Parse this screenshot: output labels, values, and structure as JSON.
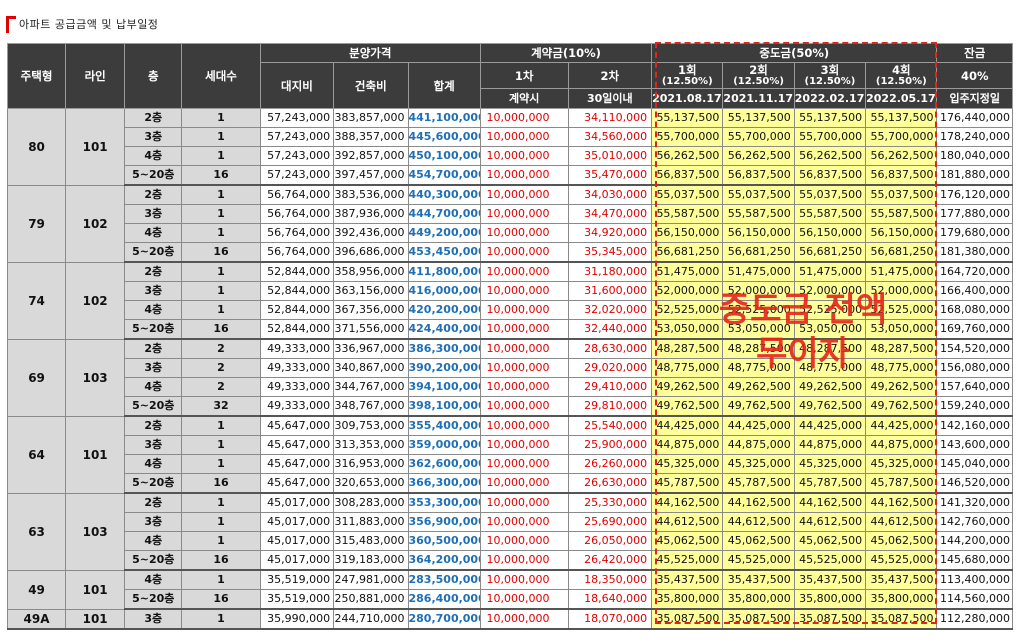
{
  "title": "아파트 공급금액 및 납부일정",
  "headers": {
    "type": "주택형",
    "line": "라인",
    "floor": "층",
    "units": "세대수",
    "sale_price": "분양가격",
    "land": "대지비",
    "building": "건축비",
    "total": "합계",
    "deposit": "계약금(10%)",
    "dep1": "1차",
    "dep2": "2차",
    "dep1_when": "계약시",
    "dep2_when": "30일이내",
    "middle": "중도금(50%)",
    "mid": [
      {
        "n": "1회",
        "r": "(12.50%)",
        "d": "2021.08.17."
      },
      {
        "n": "2회",
        "r": "(12.50%)",
        "d": "2021.11.17."
      },
      {
        "n": "3회",
        "r": "(12.50%)",
        "d": "2022.02.17."
      },
      {
        "n": "4회",
        "r": "(12.50%)",
        "d": "2022.05.17."
      }
    ],
    "balance": "잔금",
    "bal_pct": "40%",
    "bal_when": "입주지정일"
  },
  "overlay": {
    "line1": "중도금 전액",
    "line2": "무이자"
  },
  "groups": [
    {
      "type": "80",
      "line": "101",
      "rows": [
        [
          "2층",
          "1",
          "57,243,000",
          "383,857,000",
          "441,100,000",
          "10,000,000",
          "34,110,000",
          "55,137,500",
          "55,137,500",
          "55,137,500",
          "55,137,500",
          "176,440,000"
        ],
        [
          "3층",
          "1",
          "57,243,000",
          "388,357,000",
          "445,600,000",
          "10,000,000",
          "34,560,000",
          "55,700,000",
          "55,700,000",
          "55,700,000",
          "55,700,000",
          "178,240,000"
        ],
        [
          "4층",
          "1",
          "57,243,000",
          "392,857,000",
          "450,100,000",
          "10,000,000",
          "35,010,000",
          "56,262,500",
          "56,262,500",
          "56,262,500",
          "56,262,500",
          "180,040,000"
        ],
        [
          "5~20층",
          "16",
          "57,243,000",
          "397,457,000",
          "454,700,000",
          "10,000,000",
          "35,470,000",
          "56,837,500",
          "56,837,500",
          "56,837,500",
          "56,837,500",
          "181,880,000"
        ]
      ]
    },
    {
      "type": "79",
      "line": "102",
      "rows": [
        [
          "2층",
          "1",
          "56,764,000",
          "383,536,000",
          "440,300,000",
          "10,000,000",
          "34,030,000",
          "55,037,500",
          "55,037,500",
          "55,037,500",
          "55,037,500",
          "176,120,000"
        ],
        [
          "3층",
          "1",
          "56,764,000",
          "387,936,000",
          "444,700,000",
          "10,000,000",
          "34,470,000",
          "55,587,500",
          "55,587,500",
          "55,587,500",
          "55,587,500",
          "177,880,000"
        ],
        [
          "4층",
          "1",
          "56,764,000",
          "392,436,000",
          "449,200,000",
          "10,000,000",
          "34,920,000",
          "56,150,000",
          "56,150,000",
          "56,150,000",
          "56,150,000",
          "179,680,000"
        ],
        [
          "5~20층",
          "16",
          "56,764,000",
          "396,686,000",
          "453,450,000",
          "10,000,000",
          "35,345,000",
          "56,681,250",
          "56,681,250",
          "56,681,250",
          "56,681,250",
          "181,380,000"
        ]
      ]
    },
    {
      "type": "74",
      "line": "102",
      "rows": [
        [
          "2층",
          "1",
          "52,844,000",
          "358,956,000",
          "411,800,000",
          "10,000,000",
          "31,180,000",
          "51,475,000",
          "51,475,000",
          "51,475,000",
          "51,475,000",
          "164,720,000"
        ],
        [
          "3층",
          "1",
          "52,844,000",
          "363,156,000",
          "416,000,000",
          "10,000,000",
          "31,600,000",
          "52,000,000",
          "52,000,000",
          "52,000,000",
          "52,000,000",
          "166,400,000"
        ],
        [
          "4층",
          "1",
          "52,844,000",
          "367,356,000",
          "420,200,000",
          "10,000,000",
          "32,020,000",
          "52,525,000",
          "52,525,000",
          "52,525,000",
          "52,525,000",
          "168,080,000"
        ],
        [
          "5~20층",
          "16",
          "52,844,000",
          "371,556,000",
          "424,400,000",
          "10,000,000",
          "32,440,000",
          "53,050,000",
          "53,050,000",
          "53,050,000",
          "53,050,000",
          "169,760,000"
        ]
      ]
    },
    {
      "type": "69",
      "line": "103",
      "rows": [
        [
          "2층",
          "2",
          "49,333,000",
          "336,967,000",
          "386,300,000",
          "10,000,000",
          "28,630,000",
          "48,287,500",
          "48,287,500",
          "48,287,500",
          "48,287,500",
          "154,520,000"
        ],
        [
          "3층",
          "2",
          "49,333,000",
          "340,867,000",
          "390,200,000",
          "10,000,000",
          "29,020,000",
          "48,775,000",
          "48,775,000",
          "48,775,000",
          "48,775,000",
          "156,080,000"
        ],
        [
          "4층",
          "2",
          "49,333,000",
          "344,767,000",
          "394,100,000",
          "10,000,000",
          "29,410,000",
          "49,262,500",
          "49,262,500",
          "49,262,500",
          "49,262,500",
          "157,640,000"
        ],
        [
          "5~20층",
          "32",
          "49,333,000",
          "348,767,000",
          "398,100,000",
          "10,000,000",
          "29,810,000",
          "49,762,500",
          "49,762,500",
          "49,762,500",
          "49,762,500",
          "159,240,000"
        ]
      ]
    },
    {
      "type": "64",
      "line": "101",
      "rows": [
        [
          "2층",
          "1",
          "45,647,000",
          "309,753,000",
          "355,400,000",
          "10,000,000",
          "25,540,000",
          "44,425,000",
          "44,425,000",
          "44,425,000",
          "44,425,000",
          "142,160,000"
        ],
        [
          "3층",
          "1",
          "45,647,000",
          "313,353,000",
          "359,000,000",
          "10,000,000",
          "25,900,000",
          "44,875,000",
          "44,875,000",
          "44,875,000",
          "44,875,000",
          "143,600,000"
        ],
        [
          "4층",
          "1",
          "45,647,000",
          "316,953,000",
          "362,600,000",
          "10,000,000",
          "26,260,000",
          "45,325,000",
          "45,325,000",
          "45,325,000",
          "45,325,000",
          "145,040,000"
        ],
        [
          "5~20층",
          "16",
          "45,647,000",
          "320,653,000",
          "366,300,000",
          "10,000,000",
          "26,630,000",
          "45,787,500",
          "45,787,500",
          "45,787,500",
          "45,787,500",
          "146,520,000"
        ]
      ]
    },
    {
      "type": "63",
      "line": "103",
      "rows": [
        [
          "2층",
          "1",
          "45,017,000",
          "308,283,000",
          "353,300,000",
          "10,000,000",
          "25,330,000",
          "44,162,500",
          "44,162,500",
          "44,162,500",
          "44,162,500",
          "141,320,000"
        ],
        [
          "3층",
          "1",
          "45,017,000",
          "311,883,000",
          "356,900,000",
          "10,000,000",
          "25,690,000",
          "44,612,500",
          "44,612,500",
          "44,612,500",
          "44,612,500",
          "142,760,000"
        ],
        [
          "4층",
          "1",
          "45,017,000",
          "315,483,000",
          "360,500,000",
          "10,000,000",
          "26,050,000",
          "45,062,500",
          "45,062,500",
          "45,062,500",
          "45,062,500",
          "144,200,000"
        ],
        [
          "5~20층",
          "16",
          "45,017,000",
          "319,183,000",
          "364,200,000",
          "10,000,000",
          "26,420,000",
          "45,525,000",
          "45,525,000",
          "45,525,000",
          "45,525,000",
          "145,680,000"
        ]
      ]
    },
    {
      "type": "49",
      "line": "101",
      "rows": [
        [
          "4층",
          "1",
          "35,519,000",
          "247,981,000",
          "283,500,000",
          "10,000,000",
          "18,350,000",
          "35,437,500",
          "35,437,500",
          "35,437,500",
          "35,437,500",
          "113,400,000"
        ],
        [
          "5~20층",
          "16",
          "35,519,000",
          "250,881,000",
          "286,400,000",
          "10,000,000",
          "18,640,000",
          "35,800,000",
          "35,800,000",
          "35,800,000",
          "35,800,000",
          "114,560,000"
        ]
      ]
    },
    {
      "type": "49A",
      "line": "101",
      "rows": [
        [
          "3층",
          "1",
          "35,990,000",
          "244,710,000",
          "280,700,000",
          "10,000,000",
          "18,070,000",
          "35,087,500",
          "35,087,500",
          "35,087,500",
          "35,087,500",
          "112,280,000"
        ]
      ]
    }
  ]
}
